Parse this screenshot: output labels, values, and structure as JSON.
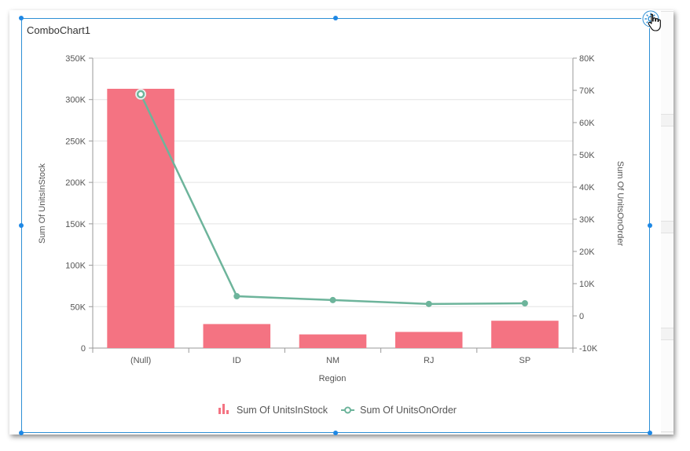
{
  "widget": {
    "title": "ComboChart1",
    "settings_icon": "gear-icon"
  },
  "colors": {
    "bar": "#f47382",
    "line": "#6db49b",
    "selection": "#2d8fd5"
  },
  "chart_data": {
    "type": "combo",
    "title": "",
    "xlabel": "Region",
    "ylabel": "Sum Of UnitsInStock",
    "y2label": "Sum Of UnitsOnOrder",
    "categories": [
      "(Null)",
      "ID",
      "NM",
      "RJ",
      "SP"
    ],
    "series": [
      {
        "name": "Sum Of UnitsInStock",
        "type": "bar",
        "axis": "left",
        "values": [
          313000,
          29000,
          16500,
          19500,
          33000
        ]
      },
      {
        "name": "Sum Of UnitsOnOrder",
        "type": "line",
        "axis": "right",
        "values": [
          68800,
          6100,
          4900,
          3700,
          3900
        ]
      }
    ],
    "ylim": [
      0,
      350000
    ],
    "y_ticks": [
      "0",
      "50K",
      "100K",
      "150K",
      "200K",
      "250K",
      "300K",
      "350K"
    ],
    "y_tick_values": [
      0,
      50000,
      100000,
      150000,
      200000,
      250000,
      300000,
      350000
    ],
    "y2lim": [
      -10000,
      80000
    ],
    "y2_ticks": [
      "-10K",
      "0",
      "10K",
      "20K",
      "30K",
      "40K",
      "50K",
      "60K",
      "70K",
      "80K"
    ],
    "y2_tick_values": [
      -10000,
      0,
      10000,
      20000,
      30000,
      40000,
      50000,
      60000,
      70000,
      80000
    ],
    "grid": true,
    "legend": "bottom-center",
    "highlighted_point": {
      "series": 1,
      "index": 0
    }
  }
}
